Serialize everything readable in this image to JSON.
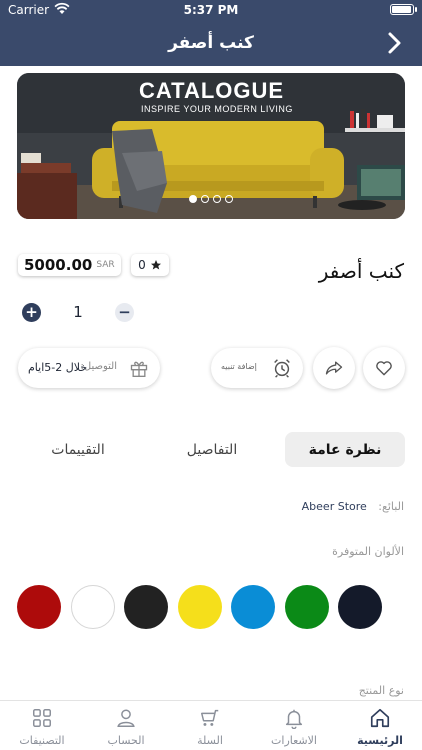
{
  "status_bar": {
    "carrier": "Carrier",
    "time": "5:37 PM"
  },
  "nav": {
    "title": "كنب أصفر",
    "back_icon": "chevron-right-icon"
  },
  "banner": {
    "title": "CATALOGUE",
    "subtitle": "INSPIRE YOUR MODERN LIVING",
    "slide_count": 4,
    "active_slide": 1
  },
  "product": {
    "name": "كنب أصفر",
    "price": "5000.00",
    "currency": "SAR",
    "rating": "0",
    "quantity": "1"
  },
  "actions": {
    "delivery_label": "التوصيل:",
    "delivery_value": "خلال 2-5ايام",
    "alert_label": "إضافة تنبيه"
  },
  "tabs": {
    "overview": "نظرة عامة",
    "details": "التفاصيل",
    "reviews": "التقييمات",
    "active": "overview"
  },
  "details": {
    "seller_label": "البائع:",
    "seller_value": "Abeer Store",
    "colors_title": "الألوان المتوفرة",
    "product_type_label": "نوع المنتج"
  },
  "colors": [
    "#ad0b0b",
    "#ffffff",
    "#222222",
    "#f5df1b",
    "#0a8dd6",
    "#0b8a17",
    "#141a2a"
  ],
  "tabbar": {
    "home": "الرئيسية",
    "notifications": "الاشعارات",
    "cart": "السلة",
    "account": "الحساب",
    "categories": "التصنيفات",
    "active": "home"
  },
  "theme": {
    "primary": "#3a4a6b",
    "accent": "#2f3e5c",
    "sofa": "#d9bb2c"
  }
}
